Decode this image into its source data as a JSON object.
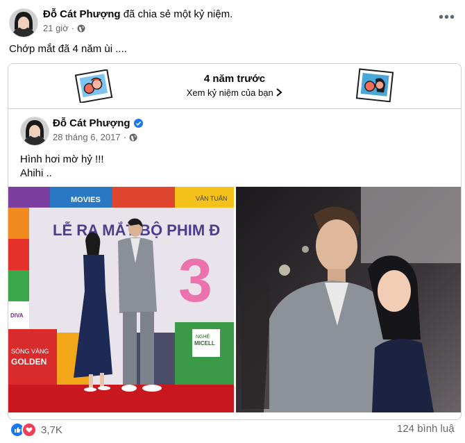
{
  "post": {
    "author": "Đỗ Cát Phượng",
    "action": " đã chia sẻ một kỷ niệm.",
    "time": "21 giờ",
    "dot": "·",
    "text": "Chớp mắt đã 4 năm ùi ...."
  },
  "memory": {
    "title": "4 năm trước",
    "link": "Xem kỷ niệm của bạn"
  },
  "original": {
    "author": "Đỗ Cát Phượng",
    "date": "28 tháng 6, 2017",
    "dot": "·",
    "line1": "Hình hơi mờ hỷ !!!",
    "line2": "Ahihi .."
  },
  "photo_left": {
    "banner_main": "LỄ RA MẮT BỘ PHIM Đ",
    "movies": "MOVIES",
    "van_tuan": "VÂN TUẤN",
    "song_vang": "SÓNG VÀNG",
    "golden": "GOLDEN",
    "diva": "DIVA",
    "nghe": "NGHỆ",
    "micell": "MICELL",
    "number": "3"
  },
  "footer": {
    "reactions": "3,7K",
    "comments": "124 bình luậ"
  },
  "colors": {
    "blue": "#1877f2",
    "like": "#1877f2",
    "love": "#f33e58",
    "verified": "#1877f2"
  }
}
